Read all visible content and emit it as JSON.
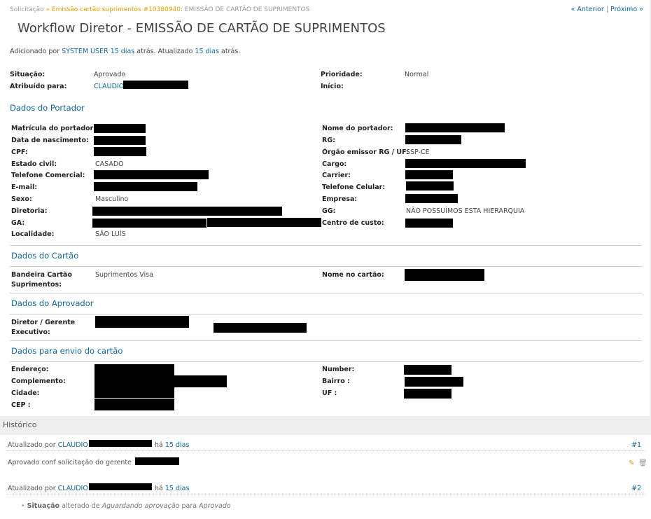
{
  "breadcrumb": {
    "root": "Solicitação",
    "sep1": " » ",
    "issue_link": "Emissão cartão suprimentos #10380940",
    "issue_title": ": EMISSÃO DE CARTÃO DE SUPRIMENTOS"
  },
  "pager": {
    "prev": "« Anterior",
    "sep": "|",
    "next": "Próximo »"
  },
  "title": "Workflow Diretor - EMISSÃO DE CARTÃO DE SUPRIMENTOS",
  "added": {
    "prefix": "Adicionado por",
    "author": "SYSTEM USER",
    "time1": "15 dias",
    "mid": "atrás. Atualizado",
    "time2": "15 dias",
    "suffix": "atrás."
  },
  "attributes": {
    "status_label": "Situação:",
    "status_value": "Aprovado",
    "assigned_label": "Atribuído para:",
    "assigned_value": "CLAUDIO",
    "priority_label": "Prioridade:",
    "priority_value": "Normal",
    "start_label": "Início:"
  },
  "sections": {
    "portador": "Dados do Portador",
    "cartao": "Dados do Cartão",
    "aprovador": "Dados do Aprovador",
    "envio": "Dados para envio do cartão"
  },
  "portador_left": [
    {
      "label": "Matrícula do portador:",
      "value": ""
    },
    {
      "label": "Data de nascimento:",
      "value": ""
    },
    {
      "label": "CPF:",
      "value": ""
    },
    {
      "label": "Estado civil:",
      "value": "CASADO"
    },
    {
      "label": "Telefone Comercial:",
      "value": ""
    },
    {
      "label": "E-mail:",
      "value": ""
    },
    {
      "label": "Sexo:",
      "value": "Masculino"
    },
    {
      "label": "Diretoria:",
      "value": ""
    },
    {
      "label": "GA:",
      "value": ""
    },
    {
      "label": "Localidade:",
      "value": "SÃO LUÍS"
    }
  ],
  "portador_right": [
    {
      "label": "Nome do portador:",
      "value": ""
    },
    {
      "label": "RG:",
      "value": ""
    },
    {
      "label": "Órgão emissor RG / UF:",
      "value": "SSP-CE"
    },
    {
      "label": "Cargo:",
      "value": ""
    },
    {
      "label": "Carrier:",
      "value": ""
    },
    {
      "label": "Telefone Celular:",
      "value": ""
    },
    {
      "label": "Empresa:",
      "value": ""
    },
    {
      "label": "GG:",
      "value": "NÃO POSSUÍMOS ESTA HIERARQUIA"
    },
    {
      "label": "Centro de custo:",
      "value": ""
    }
  ],
  "cartao": {
    "bandeira_label_1": "Bandeira Cartão",
    "bandeira_label_2": "Suprimentos:",
    "bandeira_value": "Suprimentos Visa",
    "nome_label": "Nome no cartão:"
  },
  "aprovador": {
    "label_1": "Diretor / Gerente",
    "label_2": "Executivo:"
  },
  "envio_left": [
    {
      "label": "Endereço:"
    },
    {
      "label": "Complemento:"
    },
    {
      "label": "Cidade:"
    },
    {
      "label": "CEP :"
    }
  ],
  "envio_right": [
    {
      "label": "Number:"
    },
    {
      "label": "Bairro :"
    },
    {
      "label": "UF :"
    }
  ],
  "history": {
    "title": "Histórico",
    "entries": [
      {
        "prefix": "Atualizado por",
        "author": "CLAUDIO",
        "ago": "há",
        "time": "15 dias",
        "num": "#1",
        "note": "Aprovado conf solicitação do gerente"
      },
      {
        "prefix": "Atualizado por",
        "author": "CLAUDIO",
        "ago": "há",
        "time": "15 dias",
        "num": "#2",
        "detail_field": "Situação",
        "detail_mid": "alterado de",
        "detail_from": "Aguardando aprovação",
        "detail_para": "para",
        "detail_to": "Aprovado"
      }
    ]
  },
  "colors": {
    "link": "#116699",
    "breadcrumb_link": "#e89d00",
    "redaction": "#000000",
    "history_bg": "#eeeeee"
  },
  "icons": {
    "edit": "pencil-icon",
    "delete": "trash-icon"
  }
}
